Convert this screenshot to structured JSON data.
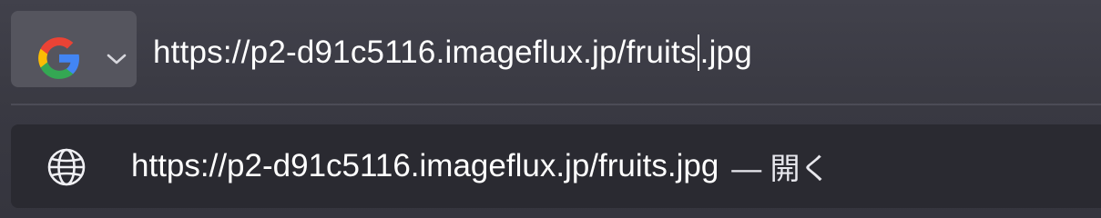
{
  "search_engine": {
    "name": "Google",
    "icon": "google-logo-icon",
    "dropdown_icon": "chevron-down-icon"
  },
  "urlbar": {
    "value_before_caret": "https://p2-d91c5116.imageflux.jp/fruits",
    "value_after_caret": ".jpg"
  },
  "suggestion": {
    "icon": "globe-icon",
    "url": "https://p2-d91c5116.imageflux.jp/fruits.jpg",
    "action": "— 開く"
  },
  "colors": {
    "background": "#3a3a44",
    "engine_button": "#55555e",
    "suggestion_bg": "#2a2a31",
    "text": "#ffffff"
  }
}
